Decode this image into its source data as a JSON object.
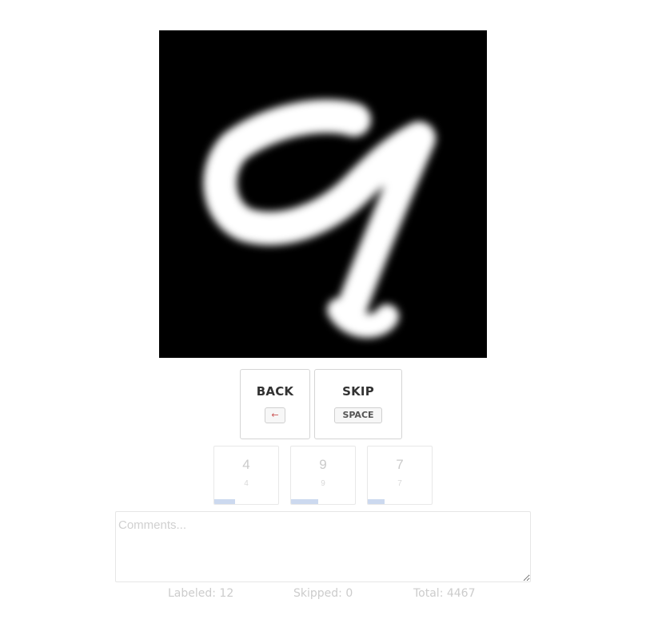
{
  "sample": {
    "digit_image": "handwritten-digit-nine"
  },
  "nav": {
    "back_label": "BACK",
    "back_key": "←",
    "skip_label": "SKIP",
    "skip_key": "SPACE"
  },
  "suggestions": [
    {
      "digit": "4",
      "key": "4",
      "confidence": 0.33
    },
    {
      "digit": "9",
      "key": "9",
      "confidence": 0.42
    },
    {
      "digit": "7",
      "key": "7",
      "confidence": 0.26
    }
  ],
  "comments": {
    "placeholder": "Comments...",
    "value": ""
  },
  "stats": {
    "labeled": "Labeled: 12",
    "skipped": "Skipped: 0",
    "total": "Total: 4467"
  }
}
